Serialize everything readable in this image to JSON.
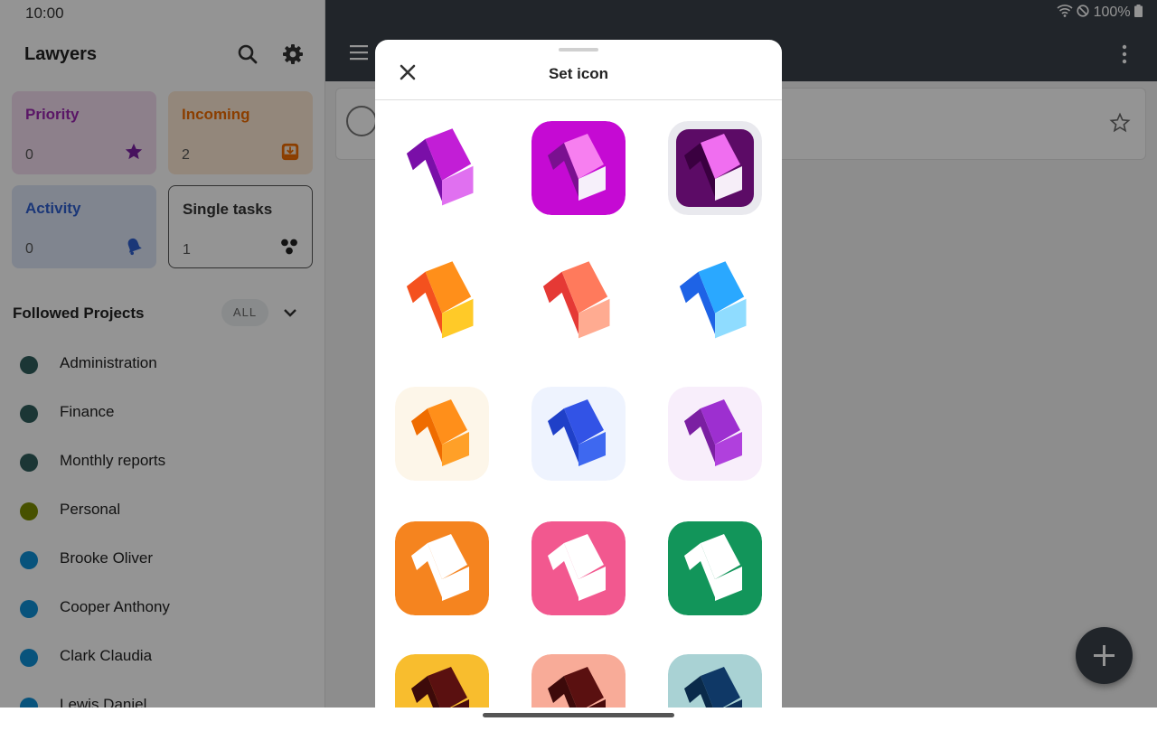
{
  "status": {
    "time": "10:00",
    "battery": "100%"
  },
  "drawer": {
    "title": "Lawyers",
    "tiles": [
      {
        "label": "Priority",
        "count": "0",
        "bg": "#f3dcf0",
        "label_color": "#9c27b0",
        "icon": "star-icon"
      },
      {
        "label": "Incoming",
        "count": "2",
        "bg": "#fde9d4",
        "label_color": "#ef6c00",
        "icon": "inbox-download-icon"
      },
      {
        "label": "Activity",
        "count": "0",
        "bg": "#dde6f7",
        "label_color": "#2f5fcf",
        "icon": "bell-icon"
      },
      {
        "label": "Single tasks",
        "count": "1",
        "bg": "#ffffff",
        "label_color": "#333333",
        "icon": "dots-cluster-icon"
      }
    ],
    "followed": {
      "title": "Followed Projects",
      "all_chip": "ALL",
      "projects": [
        {
          "name": "Administration",
          "color": "#2f5d5c"
        },
        {
          "name": "Finance",
          "color": "#2f5d5c"
        },
        {
          "name": "Monthly reports",
          "color": "#2f5d5c"
        },
        {
          "name": "Personal",
          "color": "#7a8c00"
        },
        {
          "name": "Brooke Oliver",
          "color": "#0f8fd6"
        },
        {
          "name": "Cooper Anthony",
          "color": "#0f8fd6"
        },
        {
          "name": "Clark Claudia",
          "color": "#0f8fd6"
        },
        {
          "name": "Lewis Daniel",
          "color": "#0f8fd6"
        }
      ]
    }
  },
  "sheet": {
    "title": "Set icon",
    "options": [
      {
        "style": "bare",
        "bg": "#ffffff",
        "left": "#7a0fa8",
        "right": "#e070f0",
        "top": "#c21ed6",
        "inner": ""
      },
      {
        "style": "square",
        "bg": "#c50ad3",
        "left": "#7a1090",
        "right": "#f6f0fa",
        "top": "#f77ff0",
        "inner": ""
      },
      {
        "style": "framed",
        "bg": "#e9e9ee",
        "left": "#3a0040",
        "right": "#f6eef8",
        "top": "#f06ef0",
        "inner": "#5c0b66"
      },
      {
        "style": "bare",
        "bg": "#ffffff",
        "left": "#f4511e",
        "right": "#ffca28",
        "top": "#ff8f1a",
        "inner": ""
      },
      {
        "style": "bare",
        "bg": "#ffffff",
        "left": "#e53935",
        "right": "#ffab91",
        "top": "#ff7a5c",
        "inner": ""
      },
      {
        "style": "bare",
        "bg": "#ffffff",
        "left": "#1e63e6",
        "right": "#8fdcff",
        "top": "#2aa8ff",
        "inner": ""
      },
      {
        "style": "square",
        "bg": "#fdf6e9",
        "left": "#ef6c00",
        "right": "#ffa028",
        "top": "#ff8f1a",
        "inner": ""
      },
      {
        "style": "square",
        "bg": "#eef3fe",
        "left": "#1f40c8",
        "right": "#3e68f0",
        "top": "#3253e6",
        "inner": ""
      },
      {
        "style": "square",
        "bg": "#f8eefb",
        "left": "#7b1fa2",
        "right": "#b040dd",
        "top": "#9d2fd0",
        "inner": ""
      },
      {
        "style": "square",
        "bg": "#f5841f",
        "left": "#ffffff",
        "right": "#ffffff",
        "top": "#ffffff",
        "inner": ""
      },
      {
        "style": "square",
        "bg": "#f2588f",
        "left": "#ffffff",
        "right": "#ffffff",
        "top": "#ffffff",
        "inner": ""
      },
      {
        "style": "square",
        "bg": "#12955a",
        "left": "#ffffff",
        "right": "#ffffff",
        "top": "#ffffff",
        "inner": ""
      },
      {
        "style": "square",
        "bg": "#f8bd2e",
        "left": "#3d0a0a",
        "right": "#4a0b0b",
        "top": "#5a1010",
        "inner": ""
      },
      {
        "style": "square",
        "bg": "#f8ab98",
        "left": "#3d0a0a",
        "right": "#4a0b0b",
        "top": "#5a1010",
        "inner": ""
      },
      {
        "style": "square",
        "bg": "#a9d2d4",
        "left": "#0a2a4a",
        "right": "#0c3058",
        "top": "#0f3866",
        "inner": ""
      }
    ]
  },
  "icons": {
    "search": "search-icon",
    "settings": "gear-icon",
    "menu": "hamburger-menu-icon",
    "more": "kebab-menu-icon",
    "close": "close-icon",
    "fab": "plus-icon",
    "star": "star-outline-icon"
  }
}
